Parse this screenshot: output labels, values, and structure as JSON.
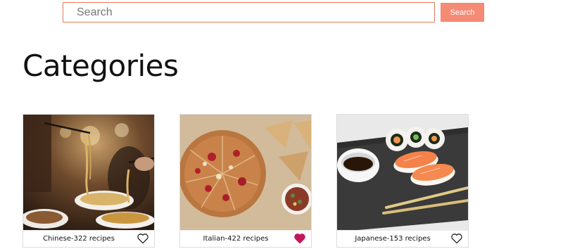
{
  "search": {
    "placeholder": "Search",
    "value": "",
    "button_label": "Search"
  },
  "page_title": "Categories",
  "colors": {
    "accent": "#f58b75",
    "heart_active": "#c2185b"
  },
  "categories": [
    {
      "label": "Chinese-322 recipes",
      "favorite": false,
      "image_icon": "noodles-photo"
    },
    {
      "label": "Italian-422 recipes",
      "favorite": true,
      "image_icon": "pizza-photo"
    },
    {
      "label": "Japanese-153 recipes",
      "favorite": false,
      "image_icon": "sushi-photo"
    }
  ]
}
